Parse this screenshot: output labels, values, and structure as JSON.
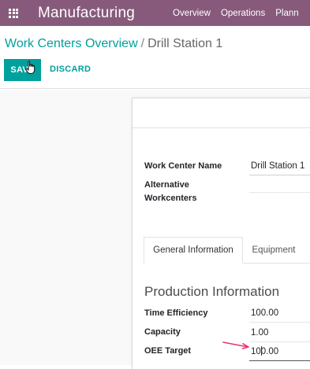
{
  "topbar": {
    "app_name": "Manufacturing",
    "menu": [
      "Overview",
      "Operations",
      "Plann"
    ]
  },
  "breadcrumb": {
    "parent": "Work Centers Overview",
    "separator": "/",
    "current": "Drill Station 1"
  },
  "actions": {
    "save": "SAVE",
    "discard": "DISCARD"
  },
  "form": {
    "work_center_name_label": "Work Center Name",
    "work_center_name_value": "Drill Station 1",
    "alternative_label_line1": "Alternative",
    "alternative_label_line2": "Workcenters",
    "tabs": [
      "General Information",
      "Equipment"
    ],
    "section_title": "Production Information",
    "time_efficiency_label": "Time Efficiency",
    "time_efficiency_value": "100.00",
    "capacity_label": "Capacity",
    "capacity_value": "1.00",
    "oee_target_label": "OEE Target",
    "oee_target_value": "100.00"
  },
  "colors": {
    "topbar": "#875a7b",
    "accent": "#00a09d",
    "annotation_arrow": "#e8336b"
  }
}
